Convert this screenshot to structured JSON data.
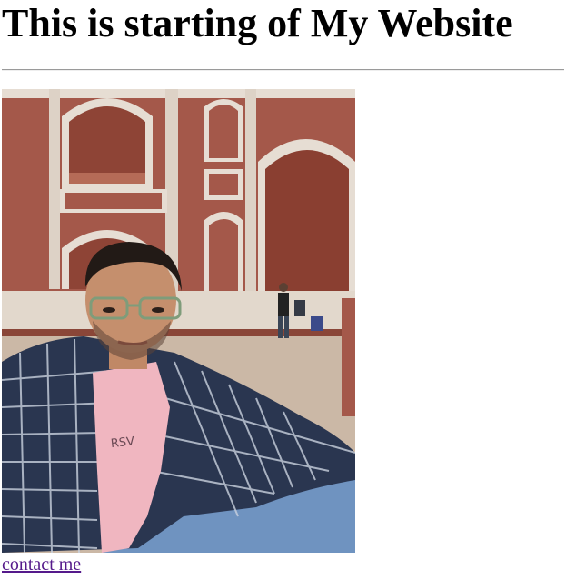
{
  "page": {
    "title": "This is starting of My Website",
    "contact_link": "contact me"
  },
  "photo": {
    "icon": "profile-photo"
  }
}
